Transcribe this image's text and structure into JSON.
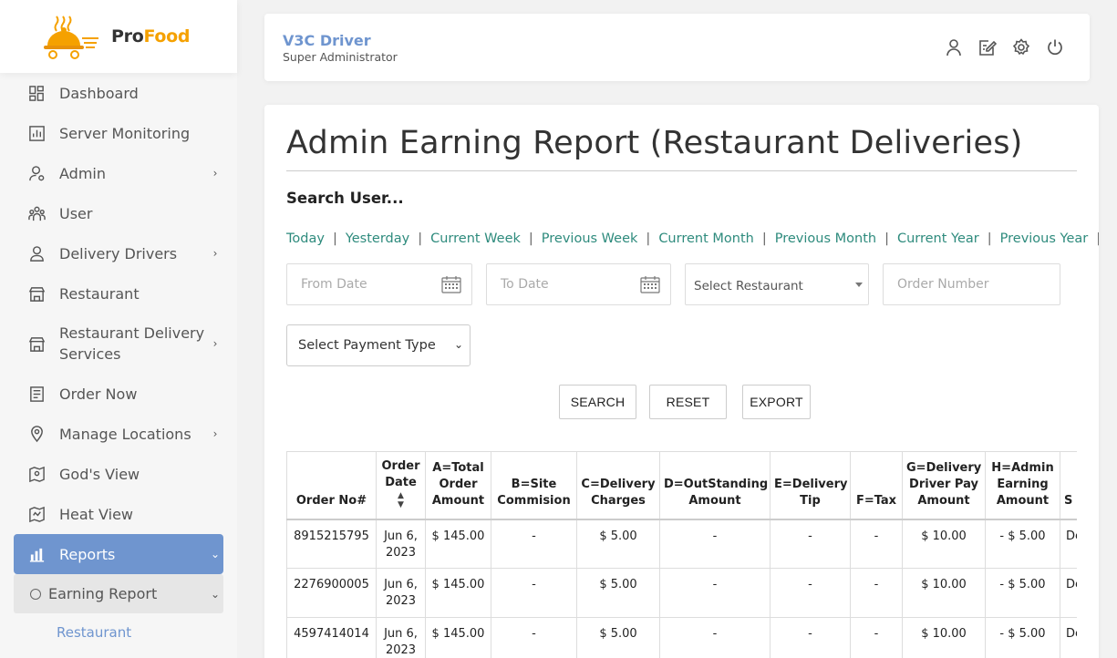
{
  "brand": {
    "pro": "Pro",
    "food": "Food"
  },
  "sidebar": {
    "items": [
      {
        "label": "Dashboard",
        "icon": "dashboard-icon",
        "has_children": false
      },
      {
        "label": "Server Monitoring",
        "icon": "chart-icon",
        "has_children": false
      },
      {
        "label": "Admin",
        "icon": "admin-user-icon",
        "has_children": true
      },
      {
        "label": "User",
        "icon": "users-icon",
        "has_children": false
      },
      {
        "label": "Delivery Drivers",
        "icon": "driver-icon",
        "has_children": true
      },
      {
        "label": "Restaurant",
        "icon": "store-icon",
        "has_children": false
      },
      {
        "label": "Restaurant Delivery Services",
        "icon": "store-icon",
        "has_children": true
      },
      {
        "label": "Order Now",
        "icon": "order-icon",
        "has_children": false
      },
      {
        "label": "Manage Locations",
        "icon": "location-pin-icon",
        "has_children": true
      },
      {
        "label": "God's View",
        "icon": "map-icon",
        "has_children": false
      },
      {
        "label": "Heat View",
        "icon": "heat-map-icon",
        "has_children": false
      },
      {
        "label": "Reports",
        "icon": "reports-icon",
        "has_children": true,
        "active": true
      }
    ],
    "submenu": {
      "label": "Earning Report"
    },
    "subsubmenu": {
      "label": "Restaurant"
    }
  },
  "header": {
    "user_name": "V3C Driver",
    "user_role": "Super Administrator",
    "icons": [
      "profile-icon",
      "edit-icon",
      "settings-icon",
      "power-icon"
    ]
  },
  "page": {
    "title": "Admin Earning Report (Restaurant Deliveries)",
    "search_title": "Search User...",
    "quick_links": [
      "Today",
      "Yesterday",
      "Current Week",
      "Previous Week",
      "Current Month",
      "Previous Month",
      "Current Year",
      "Previous Year"
    ],
    "quick_sep": "|",
    "filters": {
      "from_date_placeholder": "From Date",
      "to_date_placeholder": "To Date",
      "restaurant_select": "Select Restaurant",
      "order_number_placeholder": "Order Number",
      "payment_select": "Select Payment Type"
    },
    "buttons": {
      "search": "SEARCH",
      "reset": "RESET",
      "export": "EXPORT"
    }
  },
  "table": {
    "headers": [
      "Order No#",
      "Order Date",
      "A=Total Order Amount",
      "B=Site Commision",
      "C=Delivery Charges",
      "D=OutStanding Amount",
      "E=Delivery Tip",
      "F=Tax",
      "G=Delivery Driver Pay Amount",
      "H=Admin Earning Amount",
      "S"
    ],
    "sort_glyph": "▲▼",
    "rows": [
      [
        "8915215795",
        "Jun 6, 2023",
        "$ 145.00",
        "-",
        "$ 5.00",
        "-",
        "-",
        "-",
        "$ 10.00",
        "- $ 5.00",
        "De"
      ],
      [
        "2276900005",
        "Jun 6, 2023",
        "$ 145.00",
        "-",
        "$ 5.00",
        "-",
        "-",
        "-",
        "$ 10.00",
        "- $ 5.00",
        "De"
      ],
      [
        "4597414014",
        "Jun 6, 2023",
        "$ 145.00",
        "-",
        "$ 5.00",
        "-",
        "-",
        "-",
        "$ 10.00",
        "- $ 5.00",
        "De"
      ]
    ]
  },
  "colors": {
    "accent": "#6f95cf",
    "link": "#2e8b7d",
    "brand_orange": "#f5a100"
  }
}
